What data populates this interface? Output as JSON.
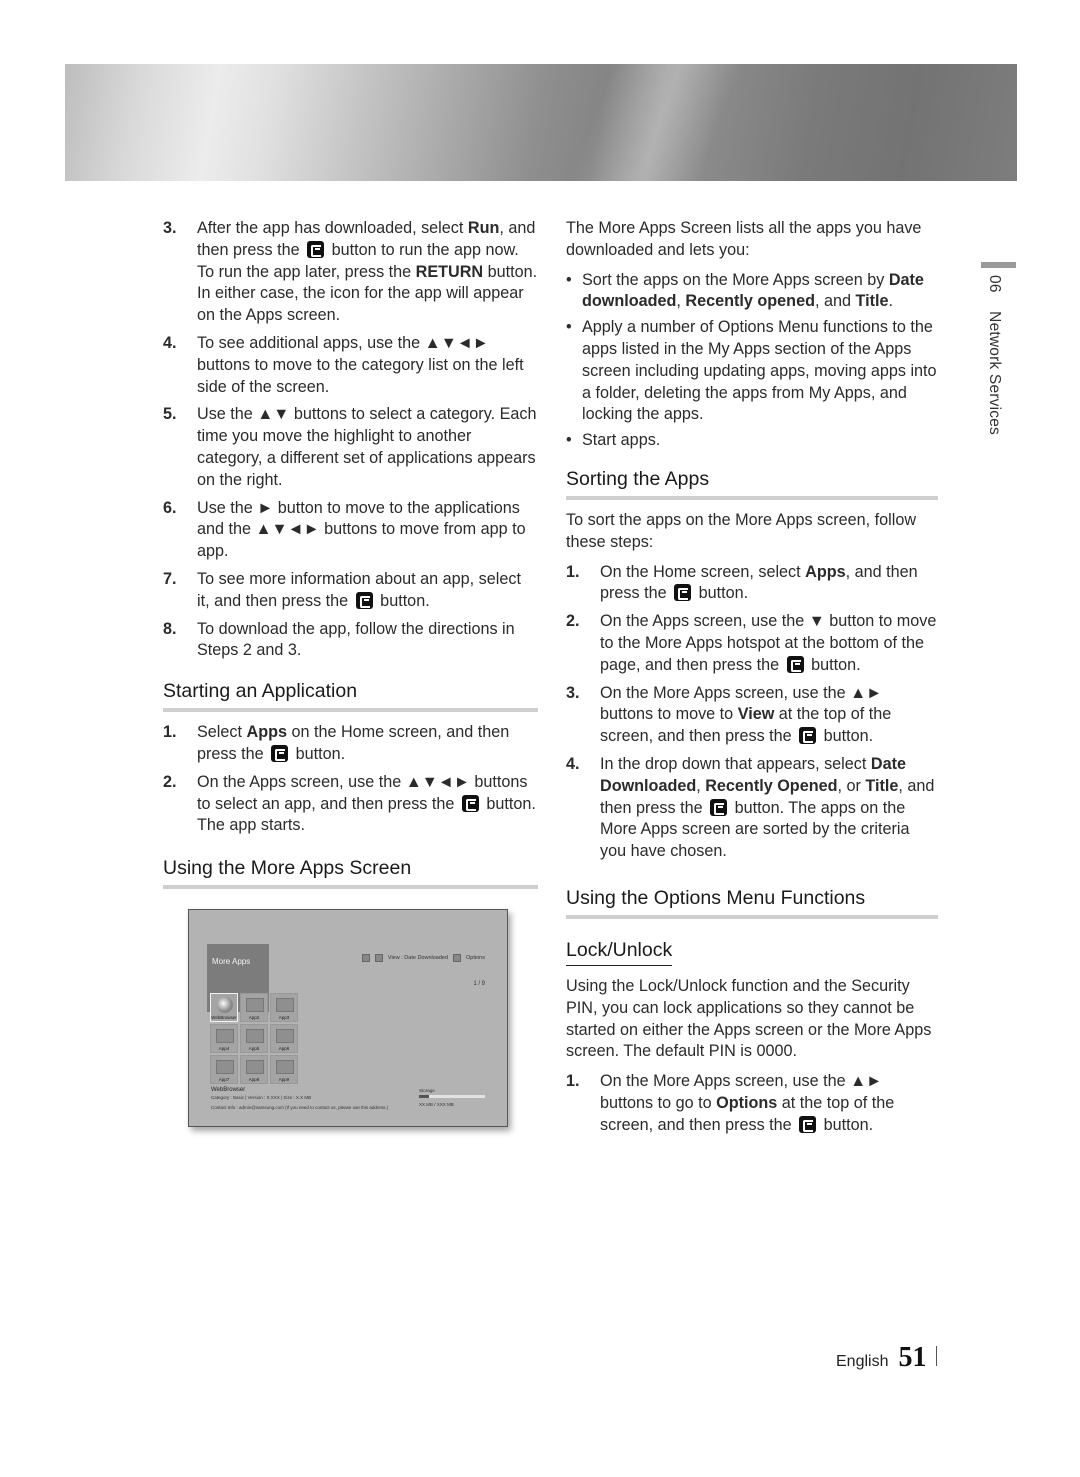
{
  "left": {
    "steps_a": [
      {
        "num": "3.",
        "parts": [
          "After the app has downloaded, select ",
          {
            "b": "Run"
          },
          ", and then press the ",
          {
            "icon": "enter"
          },
          " button to run the app now. To run the app later, press the ",
          {
            "b": "RETURN"
          },
          " button. In either case, the icon for the app will appear on the Apps screen."
        ]
      },
      {
        "num": "4.",
        "parts": [
          "To see additional apps, use the ▲▼◄► buttons to move to the category list on the left side of the screen."
        ]
      },
      {
        "num": "5.",
        "parts": [
          "Use the ▲▼ buttons to select a category. Each time you move the highlight to another category, a different set of applications appears on the right."
        ]
      },
      {
        "num": "6.",
        "parts": [
          "Use the ► button to move to the applications and the ▲▼◄► buttons to move from app to app."
        ]
      },
      {
        "num": "7.",
        "parts": [
          "To see more information about an app, select it, and then press the ",
          {
            "icon": "enter"
          },
          " button."
        ]
      },
      {
        "num": "8.",
        "parts": [
          "To download the app, follow the directions in Steps 2 and 3."
        ]
      }
    ],
    "starting_heading": "Starting an Application",
    "starting_steps": [
      {
        "num": "1.",
        "parts": [
          "Select ",
          {
            "b": "Apps"
          },
          " on the Home screen, and then press the ",
          {
            "icon": "enter"
          },
          " button."
        ]
      },
      {
        "num": "2.",
        "parts": [
          "On the Apps screen, use the ▲▼◄► buttons to select an app, and then press the ",
          {
            "icon": "enter"
          },
          " button. The app starts."
        ]
      }
    ],
    "more_apps_heading": "Using the More Apps Screen"
  },
  "tv_screen": {
    "title": "More Apps",
    "view_label": "View : Date Downloaded",
    "options_label": "Options",
    "pager": "1 / 9",
    "apps": [
      "WebBrowser",
      "App2",
      "App3",
      "App4",
      "App5",
      "App6",
      "App7",
      "App8",
      "App9"
    ],
    "selected_app": "WebBrowser",
    "info_name": "WebBrowser",
    "info_meta": "Category : Basic  |  Version : X.XXX  |  Size : X.X MB",
    "info_contact": "Contact Info : admin@samsung.com (If you need to contact us, please use this address.)",
    "storage_label": "Storage",
    "storage_used_fraction": 0.15,
    "storage_value": "XX MB / XXX MB"
  },
  "right": {
    "intro": "The More Apps Screen lists all the apps you have downloaded and lets you:",
    "bullets": [
      {
        "parts": [
          "Sort the apps on the More Apps screen by ",
          {
            "b": "Date downloaded"
          },
          ", ",
          {
            "b": "Recently opened"
          },
          ", and ",
          {
            "b": "Title"
          },
          "."
        ]
      },
      {
        "parts": [
          "Apply a number of Options Menu functions to the apps listed in the My Apps section of the Apps screen including updating apps, moving apps into a folder, deleting the apps from My Apps, and locking the apps."
        ]
      },
      {
        "parts": [
          "Start apps."
        ]
      }
    ],
    "sorting_heading": "Sorting the Apps",
    "sorting_intro": "To sort the apps on the More Apps screen, follow these steps:",
    "sorting_steps": [
      {
        "num": "1.",
        "parts": [
          "On the Home screen, select ",
          {
            "b": "Apps"
          },
          ", and then press the ",
          {
            "icon": "enter"
          },
          " button."
        ]
      },
      {
        "num": "2.",
        "parts": [
          "On the Apps screen, use the ▼ button to move to the More Apps hotspot at the bottom of the page, and then press the ",
          {
            "icon": "enter"
          },
          " button."
        ]
      },
      {
        "num": "3.",
        "parts": [
          "On the More Apps screen, use the ▲► buttons to move to ",
          {
            "b": "View"
          },
          " at the top of the screen, and then press the ",
          {
            "icon": "enter"
          },
          " button."
        ]
      },
      {
        "num": "4.",
        "parts": [
          "In the drop down that appears, select ",
          {
            "b": "Date Downloaded"
          },
          ", ",
          {
            "b": "Recently Opened"
          },
          ", or ",
          {
            "b": "Title"
          },
          ", and then press the ",
          {
            "icon": "enter"
          },
          " button. The apps on the More Apps screen are sorted by the criteria you have chosen."
        ]
      }
    ],
    "options_heading": "Using the Options Menu Functions",
    "lock_heading": "Lock/Unlock",
    "lock_intro": "Using the Lock/Unlock function and the Security PIN, you can lock applications so they cannot be started on either the Apps screen or the More Apps screen. The default PIN is 0000.",
    "lock_steps": [
      {
        "num": "1.",
        "parts": [
          "On the More Apps screen, use the ▲► buttons to go to ",
          {
            "b": "Options"
          },
          " at the top of the screen, and then press the ",
          {
            "icon": "enter"
          },
          " button."
        ]
      }
    ]
  },
  "side": {
    "chapter": "06",
    "section": "Network Services"
  },
  "footer": {
    "language": "English",
    "page": "51"
  }
}
